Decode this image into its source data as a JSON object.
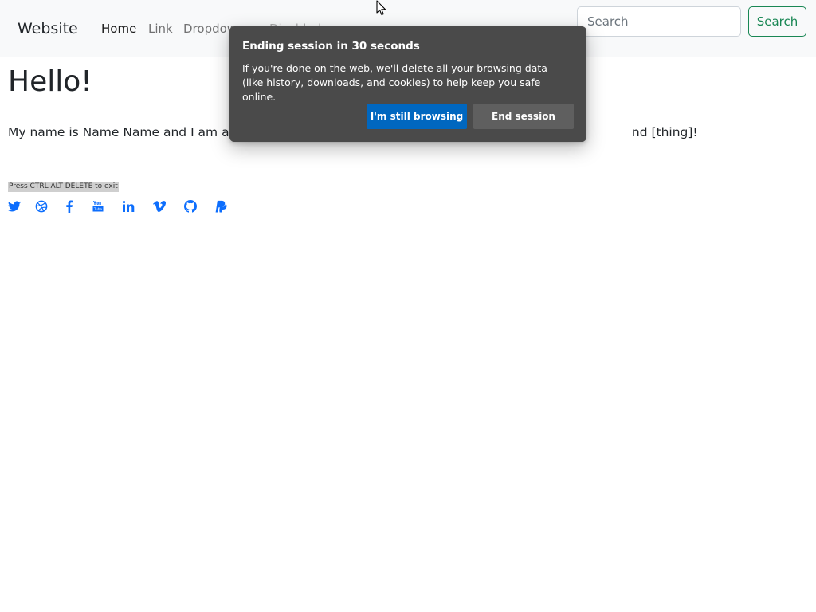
{
  "navbar": {
    "brand": "Website",
    "links": [
      {
        "label": "Home",
        "state": "active"
      },
      {
        "label": "Link",
        "state": "normal"
      },
      {
        "label": "Dropdown",
        "state": "normal"
      },
      {
        "label": "Disabled",
        "state": "disabled"
      }
    ],
    "search_placeholder": "Search",
    "search_button": "Search"
  },
  "main": {
    "heading": "Hello!",
    "intro_visible_left": "My name is Name Name and I am a pro",
    "intro_visible_right": "nd [thing]!",
    "exit_hint": "Press CTRL ALT DELETE to exit"
  },
  "social_icons": [
    "twitter-icon",
    "dribbble-icon",
    "facebook-icon",
    "youtube-icon",
    "linkedin-icon",
    "vimeo-icon",
    "github-icon",
    "paypal-icon"
  ],
  "dialog": {
    "title": "Ending session in 30 seconds",
    "body": "If you're done on the web, we'll delete all your browsing data (like history, downloads, and cookies) to help keep you safe online.",
    "primary_button": "I'm still browsing",
    "secondary_button": "End session"
  },
  "colors": {
    "link_blue": "#0d6efd",
    "search_green": "#198754",
    "dialog_bg": "#4a4a4a",
    "primary_button_bg": "#0067c0"
  }
}
